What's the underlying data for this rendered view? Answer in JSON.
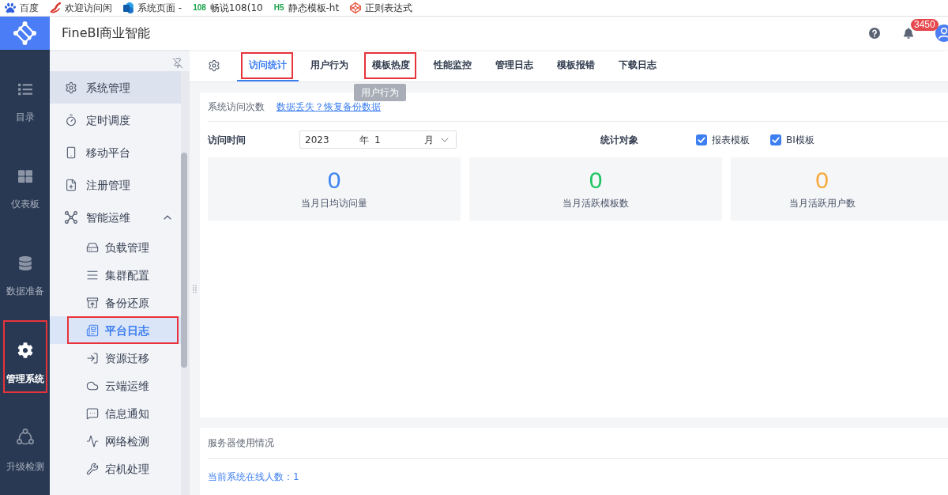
{
  "bookmarks": [
    {
      "label": "百度"
    },
    {
      "label": "欢迎访问闲"
    },
    {
      "label": "系统页面 -"
    },
    {
      "mark": "108",
      "label": "畅说108(10"
    },
    {
      "mark": "H5",
      "label": "静态模板-ht"
    },
    {
      "label": "正则表达式"
    }
  ],
  "header": {
    "title": "FineBI商业智能",
    "notification_count": "3450"
  },
  "nav": [
    {
      "label": "目录",
      "selected": false,
      "annotated": false
    },
    {
      "label": "仪表板",
      "selected": false,
      "annotated": false
    },
    {
      "label": "数据准备",
      "selected": false,
      "annotated": false
    },
    {
      "label": "管理系统",
      "selected": true,
      "annotated": true
    },
    {
      "label": "升级检测",
      "selected": false,
      "annotated": false
    }
  ],
  "menu": [
    {
      "label": "系统管理",
      "selected": false,
      "hovered": true,
      "annotated": false
    },
    {
      "label": "定时调度",
      "selected": false,
      "hovered": false,
      "annotated": false
    },
    {
      "label": "移动平台",
      "selected": false,
      "hovered": false,
      "annotated": false
    },
    {
      "label": "注册管理",
      "selected": false,
      "hovered": false,
      "annotated": false
    },
    {
      "label": "智能运维",
      "selected": false,
      "hovered": false,
      "annotated": false,
      "expanded": true,
      "children": [
        {
          "label": "负载管理",
          "selected": false,
          "hovered": false,
          "annotated": false
        },
        {
          "label": "集群配置",
          "selected": false,
          "hovered": false,
          "annotated": false
        },
        {
          "label": "备份还原",
          "selected": false,
          "hovered": false,
          "annotated": false
        },
        {
          "label": "平台日志",
          "selected": true,
          "hovered": false,
          "annotated": true
        },
        {
          "label": "资源迁移",
          "selected": false,
          "hovered": false,
          "annotated": false
        },
        {
          "label": "云端运维",
          "selected": false,
          "hovered": false,
          "annotated": false
        },
        {
          "label": "信息通知",
          "selected": false,
          "hovered": false,
          "annotated": false
        },
        {
          "label": "网络检测",
          "selected": false,
          "hovered": false,
          "annotated": false
        },
        {
          "label": "宕机处理",
          "selected": false,
          "hovered": false,
          "annotated": false
        }
      ]
    }
  ],
  "tabs": [
    {
      "label": "访问统计",
      "selected": true,
      "annotated": true
    },
    {
      "label": "用户行为",
      "selected": false,
      "annotated": false
    },
    {
      "label": "模板热度",
      "selected": false,
      "annotated": true
    },
    {
      "label": "性能监控",
      "selected": false,
      "annotated": false
    },
    {
      "label": "管理日志",
      "selected": false,
      "annotated": false
    },
    {
      "label": "模板报错",
      "selected": false,
      "annotated": false
    },
    {
      "label": "下载日志",
      "selected": false,
      "annotated": false
    }
  ],
  "tooltip": {
    "text": "用户行为"
  },
  "visits": {
    "title": "系统访问次数",
    "restore_link": "数据丢失？恢复备份数据",
    "time_label": "访问时间",
    "date": {
      "year": "2023",
      "year_unit": "年",
      "month": "1",
      "month_unit": "月"
    },
    "target_label": "统计对象",
    "targets": [
      {
        "label": "报表模板",
        "checked": true
      },
      {
        "label": "BI模板",
        "checked": true
      }
    ],
    "stats": [
      {
        "value": "0",
        "label": "当月日均访问量",
        "color": "#3d85f0"
      },
      {
        "value": "0",
        "label": "当月活跃模板数",
        "color": "#20c462"
      },
      {
        "value": "0",
        "label": "当月活跃用户数",
        "color": "#f7a93b"
      }
    ]
  },
  "server": {
    "title": "服务器使用情况",
    "online_users": "当前系统在线人数：1"
  }
}
